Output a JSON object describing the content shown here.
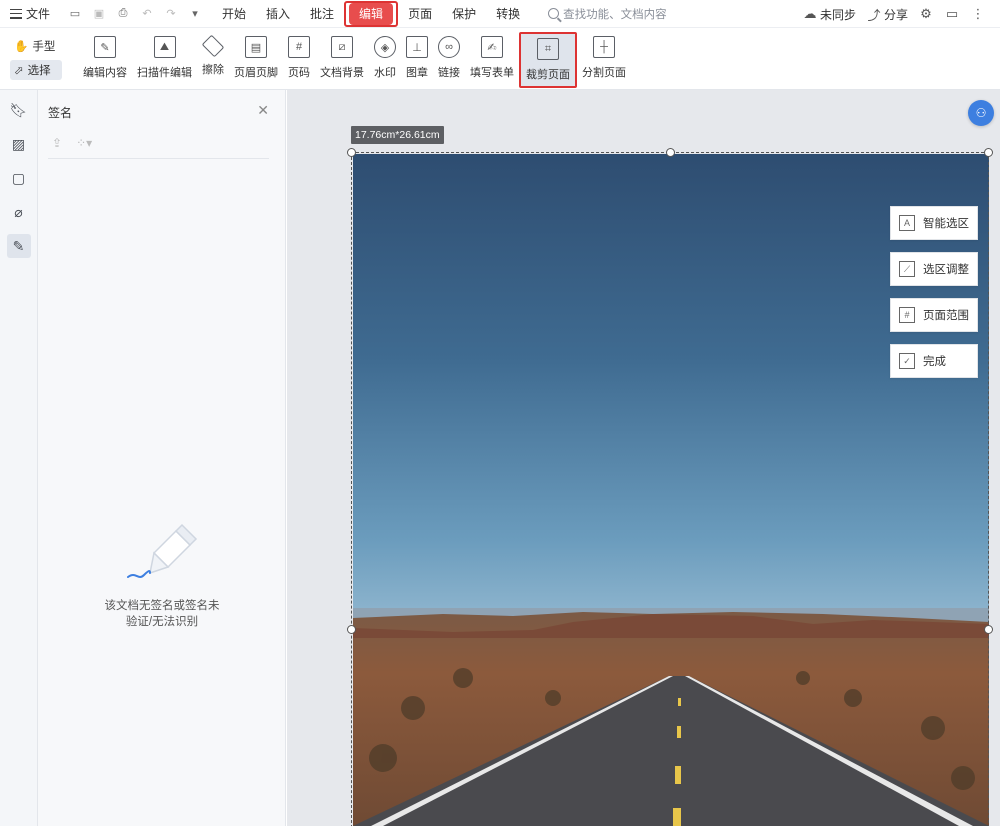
{
  "menubar": {
    "file_label": "文件",
    "tabs": [
      "开始",
      "插入",
      "批注",
      "编辑",
      "页面",
      "保护",
      "转换"
    ],
    "active_tab": "编辑",
    "search_placeholder": "查找功能、文档内容",
    "sync_label": "未同步",
    "share_label": "分享"
  },
  "ribbon": {
    "modes": [
      "手型",
      "选择"
    ],
    "selected_mode": "选择",
    "items": [
      {
        "label": "编辑内容",
        "icon": "edit-content-icon"
      },
      {
        "label": "扫描件编辑",
        "icon": "scan-edit-icon"
      },
      {
        "label": "擦除",
        "icon": "eraser-icon"
      },
      {
        "label": "页眉页脚",
        "icon": "header-footer-icon"
      },
      {
        "label": "页码",
        "icon": "page-number-icon"
      },
      {
        "label": "文档背景",
        "icon": "doc-background-icon"
      },
      {
        "label": "水印",
        "icon": "watermark-icon"
      },
      {
        "label": "图章",
        "icon": "stamp-icon"
      },
      {
        "label": "链接",
        "icon": "link-icon"
      },
      {
        "label": "填写表单",
        "icon": "fill-form-icon"
      },
      {
        "label": "裁剪页面",
        "icon": "crop-page-icon"
      },
      {
        "label": "分割页面",
        "icon": "split-page-icon"
      }
    ],
    "highlighted_item": "裁剪页面"
  },
  "panel": {
    "title": "签名",
    "empty_line1": "该文档无签名或签名未",
    "empty_line2": "验证/无法识别"
  },
  "canvas": {
    "size_label": "17.76cm*26.61cm",
    "context_buttons": [
      "智能选区",
      "选区调整",
      "页面范围",
      "完成"
    ]
  },
  "colors": {
    "accent_red": "#e84d4d",
    "highlight_border": "#d33333",
    "fab_blue": "#3d7fe0"
  }
}
